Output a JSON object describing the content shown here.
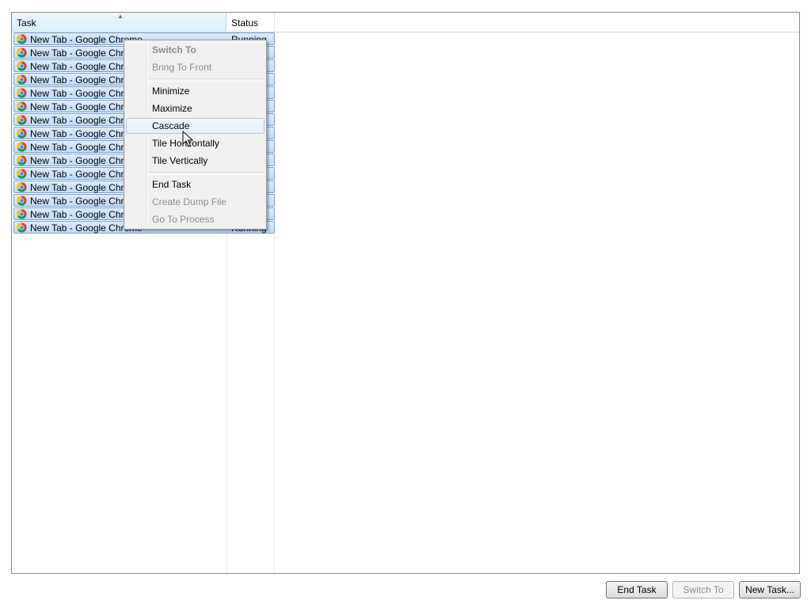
{
  "list": {
    "columns": {
      "task": "Task",
      "status": "Status"
    },
    "rows": [
      {
        "task": "New Tab - Google Chrome",
        "status": "Running"
      },
      {
        "task": "New Tab - Google Chrome",
        "status": "Running"
      },
      {
        "task": "New Tab - Google Chrome",
        "status": "Running"
      },
      {
        "task": "New Tab - Google Chrome",
        "status": "Running"
      },
      {
        "task": "New Tab - Google Chrome",
        "status": "Running"
      },
      {
        "task": "New Tab - Google Chrome",
        "status": "Running"
      },
      {
        "task": "New Tab - Google Chrome",
        "status": "Running"
      },
      {
        "task": "New Tab - Google Chrome",
        "status": "Running"
      },
      {
        "task": "New Tab - Google Chrome",
        "status": "Running"
      },
      {
        "task": "New Tab - Google Chrome",
        "status": "Running"
      },
      {
        "task": "New Tab - Google Chrome",
        "status": "Running"
      },
      {
        "task": "New Tab - Google Chrome",
        "status": "Running"
      },
      {
        "task": "New Tab - Google Chrome",
        "status": "Running"
      },
      {
        "task": "New Tab - Google Chrome",
        "status": "Running"
      },
      {
        "task": "New Tab - Google Chrome",
        "status": "Running"
      }
    ],
    "row_icon": "chrome-icon",
    "selection_color": "#c1dcfc"
  },
  "context_menu": {
    "items": [
      {
        "label": "Switch To"
      },
      {
        "label": "Bring To Front"
      },
      {
        "label": "Minimize"
      },
      {
        "label": "Maximize"
      },
      {
        "label": "Cascade"
      },
      {
        "label": "Tile Horizontally"
      },
      {
        "label": "Tile Vertically"
      },
      {
        "label": "End Task"
      },
      {
        "label": "Create Dump File"
      },
      {
        "label": "Go To Process"
      }
    ]
  },
  "buttons": {
    "end_task": "End Task",
    "switch_to": "Switch To",
    "new_task": "New Task..."
  }
}
